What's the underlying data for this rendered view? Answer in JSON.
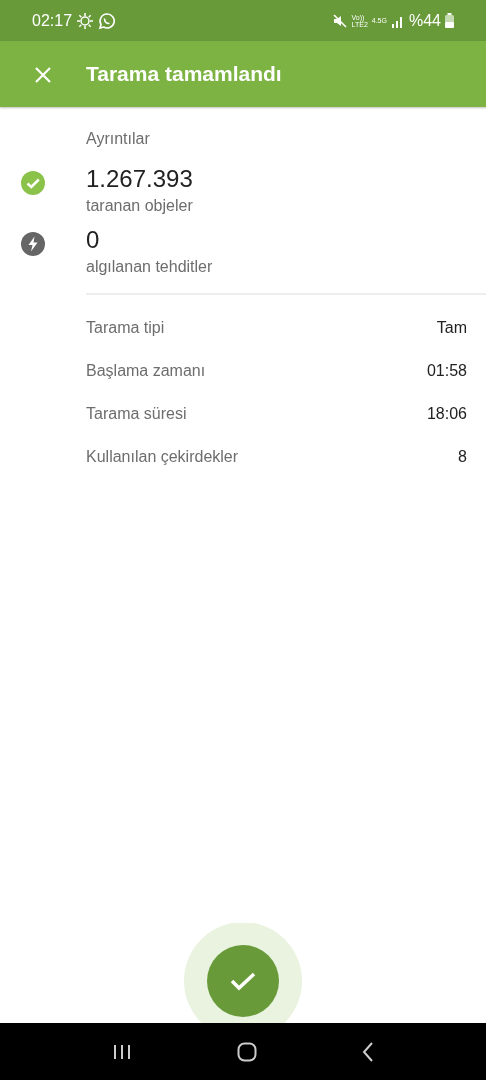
{
  "status_bar": {
    "time": "02:17",
    "network": [
      "Vo))",
      "LTE2",
      "4.5G"
    ],
    "battery": "%44"
  },
  "app_bar": {
    "title": "Tarama tamamlandı"
  },
  "section_title": "Ayrıntılar",
  "stats": [
    {
      "kind": "success",
      "value": "1.267.393",
      "label": "taranan objeler"
    },
    {
      "kind": "threat",
      "value": "0",
      "label": "algılanan tehditler"
    }
  ],
  "details": [
    {
      "label": "Tarama tipi",
      "value": "Tam"
    },
    {
      "label": "Başlama zamanı",
      "value": "01:58"
    },
    {
      "label": "Tarama süresi",
      "value": "18:06"
    },
    {
      "label": "Kullanılan çekirdekler",
      "value": "8"
    }
  ]
}
